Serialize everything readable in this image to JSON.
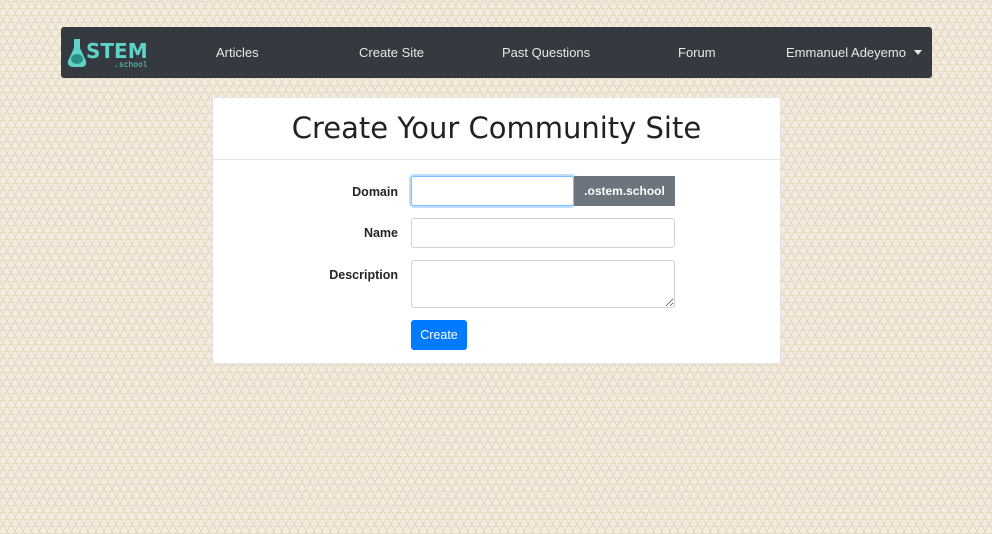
{
  "navbar": {
    "logo_alt": "STEM.school",
    "logo_text_main": "STEM",
    "logo_text_sub": ".school",
    "items": [
      {
        "label": "Articles"
      },
      {
        "label": "Create Site"
      },
      {
        "label": "Past Questions"
      },
      {
        "label": "Forum"
      }
    ],
    "user_menu": {
      "label": "Emmanuel Adeyemo"
    }
  },
  "form": {
    "title": "Create Your Community Site",
    "domain": {
      "label": "Domain",
      "value": "",
      "placeholder": "",
      "suffix": ".ostem.school"
    },
    "name": {
      "label": "Name",
      "value": "",
      "placeholder": ""
    },
    "description": {
      "label": "Description",
      "value": "",
      "placeholder": ""
    },
    "submit_label": "Create"
  },
  "colors": {
    "navbar_bg": "#343a40",
    "primary": "#007bff",
    "addon_bg": "#6c757d",
    "logo_teal": "#5fd3c8"
  }
}
